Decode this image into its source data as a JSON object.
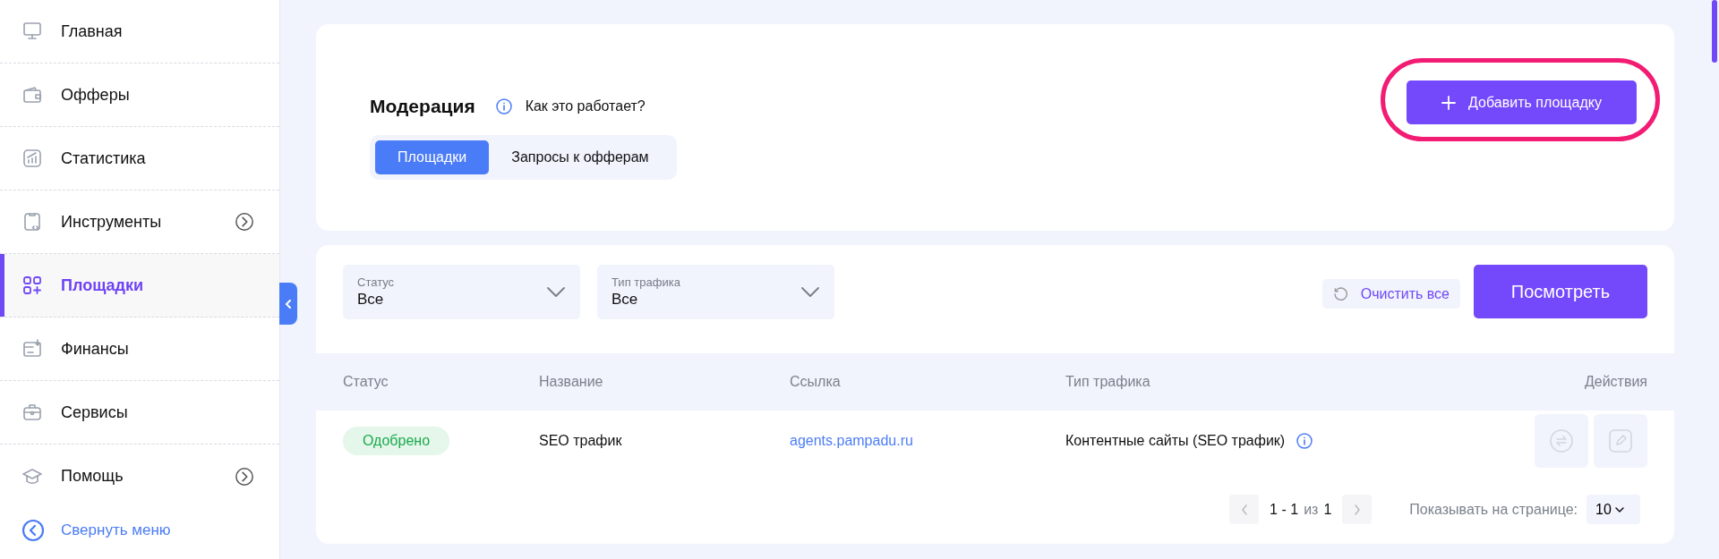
{
  "sidebar": {
    "items": [
      {
        "label": "Главная",
        "selected": false,
        "submenu": false
      },
      {
        "label": "Офферы",
        "selected": false,
        "submenu": false
      },
      {
        "label": "Статистика",
        "selected": false,
        "submenu": false
      },
      {
        "label": "Инструменты",
        "selected": false,
        "submenu": true
      },
      {
        "label": "Площадки",
        "selected": true,
        "submenu": false
      },
      {
        "label": "Финансы",
        "selected": false,
        "submenu": false
      },
      {
        "label": "Сервисы",
        "selected": false,
        "submenu": false
      },
      {
        "label": "Помощь",
        "selected": false,
        "submenu": true
      }
    ],
    "collapse": "Свернуть меню"
  },
  "header": {
    "title": "Модерация",
    "help_link": "Как это работает?",
    "tabs": [
      {
        "label": "Площадки",
        "selected": true
      },
      {
        "label": "Запросы к офферам",
        "selected": false
      }
    ],
    "add_button": {
      "label": "Добавить площадку",
      "highlighted": true
    }
  },
  "filters": [
    {
      "label": "Статус",
      "value": "Все"
    },
    {
      "label": "Тип трафика",
      "value": "Все"
    }
  ],
  "clear_button": "Очистить все",
  "view_button": "Посмотреть",
  "table": {
    "columns": [
      "Статус",
      "Название",
      "Ссылка",
      "Тип трафика",
      "Действия"
    ],
    "rows": [
      {
        "status": "Одобрено",
        "name": "SEO трафик",
        "link": "agents.pampadu.ru",
        "traffic": "Контентные сайты (SEO трафик)"
      }
    ]
  },
  "pagination": {
    "range": "1 - 1",
    "of": "из",
    "total": "1",
    "per_page_label": "Показывать на странице:",
    "per_page": "10"
  }
}
